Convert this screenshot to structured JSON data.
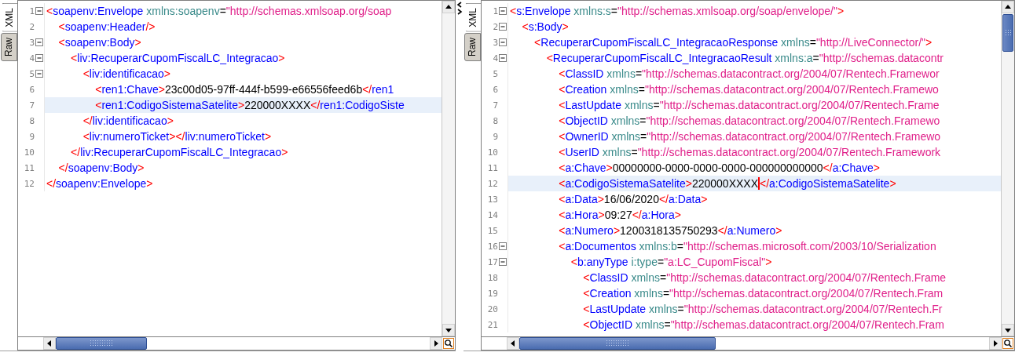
{
  "panes": [
    {
      "tabs": [
        {
          "label": "XML",
          "selected": true
        },
        {
          "label": "Raw",
          "selected": false
        }
      ],
      "lines": [
        {
          "number": "1",
          "fold": true,
          "current": false,
          "tokens": [
            {
              "kind": "bracket",
              "text": "<"
            },
            {
              "kind": "tag",
              "text": "soapenv:Envelope"
            },
            {
              "kind": "attr",
              "text": " xmlns:soapenv"
            },
            {
              "kind": "equals",
              "text": "="
            },
            {
              "kind": "value",
              "text": "\"http://schemas.xmlsoap.org/soap"
            }
          ]
        },
        {
          "number": "2",
          "fold": false,
          "current": false,
          "tokens": [
            {
              "kind": "bracket",
              "text": "    <"
            },
            {
              "kind": "tag",
              "text": "soapenv:Header"
            },
            {
              "kind": "bracket",
              "text": "/>"
            }
          ]
        },
        {
          "number": "3",
          "fold": true,
          "current": false,
          "tokens": [
            {
              "kind": "bracket",
              "text": "    <"
            },
            {
              "kind": "tag",
              "text": "soapenv:Body"
            },
            {
              "kind": "bracket",
              "text": ">"
            }
          ]
        },
        {
          "number": "4",
          "fold": true,
          "current": false,
          "tokens": [
            {
              "kind": "bracket",
              "text": "        <"
            },
            {
              "kind": "tag",
              "text": "liv:RecuperarCupomFiscalLC_Integracao"
            },
            {
              "kind": "bracket",
              "text": ">"
            }
          ]
        },
        {
          "number": "5",
          "fold": true,
          "current": false,
          "tokens": [
            {
              "kind": "bracket",
              "text": "            <"
            },
            {
              "kind": "tag",
              "text": "liv:identificacao"
            },
            {
              "kind": "bracket",
              "text": ">"
            }
          ]
        },
        {
          "number": "6",
          "fold": false,
          "current": false,
          "tokens": [
            {
              "kind": "bracket",
              "text": "                <"
            },
            {
              "kind": "tag",
              "text": "ren1:Chave"
            },
            {
              "kind": "bracket",
              "text": ">"
            },
            {
              "kind": "text",
              "text": "23c00d05-97ff-444f-b599-e66556feed6b"
            },
            {
              "kind": "bracket",
              "text": "</"
            },
            {
              "kind": "tag",
              "text": "ren1"
            }
          ]
        },
        {
          "number": "7",
          "fold": false,
          "current": true,
          "tokens": [
            {
              "kind": "bracket",
              "text": "                <"
            },
            {
              "kind": "tag",
              "text": "ren1:CodigoSistemaSatelite"
            },
            {
              "kind": "bracket",
              "text": ">"
            },
            {
              "kind": "text",
              "text": "220000XXXX"
            },
            {
              "kind": "bracket",
              "text": "</"
            },
            {
              "kind": "tag",
              "text": "ren1:CodigoSiste"
            }
          ]
        },
        {
          "number": "8",
          "fold": false,
          "current": false,
          "tokens": [
            {
              "kind": "bracket",
              "text": "            </"
            },
            {
              "kind": "tag",
              "text": "liv:identificacao"
            },
            {
              "kind": "bracket",
              "text": ">"
            }
          ]
        },
        {
          "number": "9",
          "fold": false,
          "current": false,
          "tokens": [
            {
              "kind": "bracket",
              "text": "            <"
            },
            {
              "kind": "tag",
              "text": "liv:numeroTicket"
            },
            {
              "kind": "bracket",
              "text": "></"
            },
            {
              "kind": "tag",
              "text": "liv:numeroTicket"
            },
            {
              "kind": "bracket",
              "text": ">"
            }
          ]
        },
        {
          "number": "10",
          "fold": false,
          "current": false,
          "tokens": [
            {
              "kind": "bracket",
              "text": "        </"
            },
            {
              "kind": "tag",
              "text": "liv:RecuperarCupomFiscalLC_Integracao"
            },
            {
              "kind": "bracket",
              "text": ">"
            }
          ]
        },
        {
          "number": "11",
          "fold": false,
          "current": false,
          "tokens": [
            {
              "kind": "bracket",
              "text": "    </"
            },
            {
              "kind": "tag",
              "text": "soapenv:Body"
            },
            {
              "kind": "bracket",
              "text": ">"
            }
          ]
        },
        {
          "number": "12",
          "fold": false,
          "current": false,
          "tokens": [
            {
              "kind": "bracket",
              "text": "</"
            },
            {
              "kind": "tag",
              "text": "soapenv:Envelope"
            },
            {
              "kind": "bracket",
              "text": ">"
            }
          ]
        }
      ]
    },
    {
      "tabs": [
        {
          "label": "XML",
          "selected": true
        },
        {
          "label": "Raw",
          "selected": false
        }
      ],
      "lines": [
        {
          "number": "1",
          "fold": true,
          "current": false,
          "tokens": [
            {
              "kind": "bracket",
              "text": "<"
            },
            {
              "kind": "tag",
              "text": "s:Envelope"
            },
            {
              "kind": "attr",
              "text": " xmlns:s"
            },
            {
              "kind": "equals",
              "text": "="
            },
            {
              "kind": "value",
              "text": "\"http://schemas.xmlsoap.org/soap/envelope/\""
            },
            {
              "kind": "bracket",
              "text": ">"
            }
          ]
        },
        {
          "number": "2",
          "fold": true,
          "current": false,
          "tokens": [
            {
              "kind": "bracket",
              "text": "    <"
            },
            {
              "kind": "tag",
              "text": "s:Body"
            },
            {
              "kind": "bracket",
              "text": ">"
            }
          ]
        },
        {
          "number": "3",
          "fold": true,
          "current": false,
          "tokens": [
            {
              "kind": "bracket",
              "text": "        <"
            },
            {
              "kind": "tag",
              "text": "RecuperarCupomFiscalLC_IntegracaoResponse"
            },
            {
              "kind": "attr",
              "text": " xmlns"
            },
            {
              "kind": "equals",
              "text": "="
            },
            {
              "kind": "value",
              "text": "\"http://LiveConnector/\""
            },
            {
              "kind": "bracket",
              "text": ">"
            }
          ]
        },
        {
          "number": "4",
          "fold": true,
          "current": false,
          "tokens": [
            {
              "kind": "bracket",
              "text": "            <"
            },
            {
              "kind": "tag",
              "text": "RecuperarCupomFiscalLC_IntegracaoResult"
            },
            {
              "kind": "attr",
              "text": " xmlns:a"
            },
            {
              "kind": "equals",
              "text": "="
            },
            {
              "kind": "value",
              "text": "\"http://schemas.datacontr"
            }
          ]
        },
        {
          "number": "5",
          "fold": false,
          "current": false,
          "tokens": [
            {
              "kind": "bracket",
              "text": "                <"
            },
            {
              "kind": "tag",
              "text": "ClassID"
            },
            {
              "kind": "attr",
              "text": " xmlns"
            },
            {
              "kind": "equals",
              "text": "="
            },
            {
              "kind": "value",
              "text": "\"http://schemas.datacontract.org/2004/07/Rentech.Framewor"
            }
          ]
        },
        {
          "number": "6",
          "fold": false,
          "current": false,
          "tokens": [
            {
              "kind": "bracket",
              "text": "                <"
            },
            {
              "kind": "tag",
              "text": "Creation"
            },
            {
              "kind": "attr",
              "text": " xmlns"
            },
            {
              "kind": "equals",
              "text": "="
            },
            {
              "kind": "value",
              "text": "\"http://schemas.datacontract.org/2004/07/Rentech.Framewo"
            }
          ]
        },
        {
          "number": "7",
          "fold": false,
          "current": false,
          "tokens": [
            {
              "kind": "bracket",
              "text": "                <"
            },
            {
              "kind": "tag",
              "text": "LastUpdate"
            },
            {
              "kind": "attr",
              "text": " xmlns"
            },
            {
              "kind": "equals",
              "text": "="
            },
            {
              "kind": "value",
              "text": "\"http://schemas.datacontract.org/2004/07/Rentech.Frame"
            }
          ]
        },
        {
          "number": "8",
          "fold": false,
          "current": false,
          "tokens": [
            {
              "kind": "bracket",
              "text": "                <"
            },
            {
              "kind": "tag",
              "text": "ObjectID"
            },
            {
              "kind": "attr",
              "text": " xmlns"
            },
            {
              "kind": "equals",
              "text": "="
            },
            {
              "kind": "value",
              "text": "\"http://schemas.datacontract.org/2004/07/Rentech.Framewo"
            }
          ]
        },
        {
          "number": "9",
          "fold": false,
          "current": false,
          "tokens": [
            {
              "kind": "bracket",
              "text": "                <"
            },
            {
              "kind": "tag",
              "text": "OwnerID"
            },
            {
              "kind": "attr",
              "text": " xmlns"
            },
            {
              "kind": "equals",
              "text": "="
            },
            {
              "kind": "value",
              "text": "\"http://schemas.datacontract.org/2004/07/Rentech.Framewo"
            }
          ]
        },
        {
          "number": "10",
          "fold": false,
          "current": false,
          "tokens": [
            {
              "kind": "bracket",
              "text": "                <"
            },
            {
              "kind": "tag",
              "text": "UserID"
            },
            {
              "kind": "attr",
              "text": " xmlns"
            },
            {
              "kind": "equals",
              "text": "="
            },
            {
              "kind": "value",
              "text": "\"http://schemas.datacontract.org/2004/07/Rentech.Framework"
            }
          ]
        },
        {
          "number": "11",
          "fold": false,
          "current": false,
          "tokens": [
            {
              "kind": "bracket",
              "text": "                <"
            },
            {
              "kind": "tag",
              "text": "a:Chave"
            },
            {
              "kind": "bracket",
              "text": ">"
            },
            {
              "kind": "text",
              "text": "00000000-0000-0000-0000-000000000000"
            },
            {
              "kind": "bracket",
              "text": "</"
            },
            {
              "kind": "tag",
              "text": "a:Chave"
            },
            {
              "kind": "bracket",
              "text": ">"
            }
          ]
        },
        {
          "number": "12",
          "fold": false,
          "current": true,
          "tokens": [
            {
              "kind": "bracket",
              "text": "                <"
            },
            {
              "kind": "tag",
              "text": "a:CodigoSistemaSatelite"
            },
            {
              "kind": "bracket",
              "text": ">"
            },
            {
              "kind": "text",
              "text": "220000XXXX"
            },
            {
              "kind": "caret"
            },
            {
              "kind": "bracket",
              "text": "</"
            },
            {
              "kind": "tag",
              "text": "a:CodigoSistemaSatelite"
            },
            {
              "kind": "bracket",
              "text": ">"
            }
          ]
        },
        {
          "number": "13",
          "fold": false,
          "current": false,
          "tokens": [
            {
              "kind": "bracket",
              "text": "                <"
            },
            {
              "kind": "tag",
              "text": "a:Data"
            },
            {
              "kind": "bracket",
              "text": ">"
            },
            {
              "kind": "text",
              "text": "16/06/2020"
            },
            {
              "kind": "bracket",
              "text": "</"
            },
            {
              "kind": "tag",
              "text": "a:Data"
            },
            {
              "kind": "bracket",
              "text": ">"
            }
          ]
        },
        {
          "number": "14",
          "fold": false,
          "current": false,
          "tokens": [
            {
              "kind": "bracket",
              "text": "                <"
            },
            {
              "kind": "tag",
              "text": "a:Hora"
            },
            {
              "kind": "bracket",
              "text": ">"
            },
            {
              "kind": "text",
              "text": "09:27"
            },
            {
              "kind": "bracket",
              "text": "</"
            },
            {
              "kind": "tag",
              "text": "a:Hora"
            },
            {
              "kind": "bracket",
              "text": ">"
            }
          ]
        },
        {
          "number": "15",
          "fold": false,
          "current": false,
          "tokens": [
            {
              "kind": "bracket",
              "text": "                <"
            },
            {
              "kind": "tag",
              "text": "a:Numero"
            },
            {
              "kind": "bracket",
              "text": ">"
            },
            {
              "kind": "text",
              "text": "1200318135750293"
            },
            {
              "kind": "bracket",
              "text": "</"
            },
            {
              "kind": "tag",
              "text": "a:Numero"
            },
            {
              "kind": "bracket",
              "text": ">"
            }
          ]
        },
        {
          "number": "16",
          "fold": true,
          "current": false,
          "tokens": [
            {
              "kind": "bracket",
              "text": "                <"
            },
            {
              "kind": "tag",
              "text": "a:Documentos"
            },
            {
              "kind": "attr",
              "text": " xmlns:b"
            },
            {
              "kind": "equals",
              "text": "="
            },
            {
              "kind": "value",
              "text": "\"http://schemas.microsoft.com/2003/10/Serialization"
            }
          ]
        },
        {
          "number": "17",
          "fold": true,
          "current": false,
          "tokens": [
            {
              "kind": "bracket",
              "text": "                    <"
            },
            {
              "kind": "tag",
              "text": "b:anyType"
            },
            {
              "kind": "attr",
              "text": " i:type"
            },
            {
              "kind": "equals",
              "text": "="
            },
            {
              "kind": "value",
              "text": "\"a:LC_CupomFiscal\""
            },
            {
              "kind": "bracket",
              "text": ">"
            }
          ]
        },
        {
          "number": "18",
          "fold": false,
          "current": false,
          "tokens": [
            {
              "kind": "bracket",
              "text": "                        <"
            },
            {
              "kind": "tag",
              "text": "ClassID"
            },
            {
              "kind": "attr",
              "text": " xmlns"
            },
            {
              "kind": "equals",
              "text": "="
            },
            {
              "kind": "value",
              "text": "\"http://schemas.datacontract.org/2004/07/Rentech.Frame"
            }
          ]
        },
        {
          "number": "19",
          "fold": false,
          "current": false,
          "tokens": [
            {
              "kind": "bracket",
              "text": "                        <"
            },
            {
              "kind": "tag",
              "text": "Creation"
            },
            {
              "kind": "attr",
              "text": " xmlns"
            },
            {
              "kind": "equals",
              "text": "="
            },
            {
              "kind": "value",
              "text": "\"http://schemas.datacontract.org/2004/07/Rentech.Fram"
            }
          ]
        },
        {
          "number": "20",
          "fold": false,
          "current": false,
          "tokens": [
            {
              "kind": "bracket",
              "text": "                        <"
            },
            {
              "kind": "tag",
              "text": "LastUpdate"
            },
            {
              "kind": "attr",
              "text": " xmlns"
            },
            {
              "kind": "equals",
              "text": "="
            },
            {
              "kind": "value",
              "text": "\"http://schemas.datacontract.org/2004/07/Rentech.Fr"
            }
          ]
        },
        {
          "number": "21",
          "fold": false,
          "current": false,
          "tokens": [
            {
              "kind": "bracket",
              "text": "                        <"
            },
            {
              "kind": "tag",
              "text": "ObjectID"
            },
            {
              "kind": "attr",
              "text": " xmlns"
            },
            {
              "kind": "equals",
              "text": "="
            },
            {
              "kind": "value",
              "text": "\"http://schemas.datacontract.org/2004/07/Rentech.Fram"
            }
          ]
        }
      ]
    }
  ]
}
